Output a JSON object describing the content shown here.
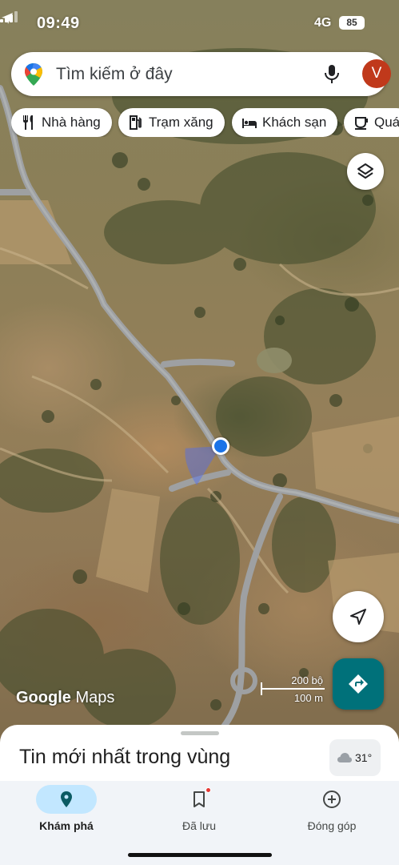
{
  "status_bar": {
    "time": "09:49",
    "network": "4G",
    "battery": "85"
  },
  "search": {
    "placeholder": "Tìm kiếm ở đây",
    "avatar_letter": "V"
  },
  "chips": [
    {
      "label": "Nhà hàng",
      "icon": "restaurant-icon"
    },
    {
      "label": "Trạm xăng",
      "icon": "gas-station-icon"
    },
    {
      "label": "Khách sạn",
      "icon": "hotel-icon"
    },
    {
      "label": "Quá",
      "icon": "coffee-icon"
    }
  ],
  "map": {
    "watermark_google": "Google",
    "watermark_maps": "Maps",
    "scale_top": "200 bộ",
    "scale_bottom": "100 m"
  },
  "sheet": {
    "title": "Tin mới nhất trong vùng",
    "weather_temp": "31°"
  },
  "bottom_nav": [
    {
      "label": "Khám phá",
      "icon": "explore-pin-icon",
      "active": true
    },
    {
      "label": "Đã lưu",
      "icon": "bookmark-icon",
      "active": false
    },
    {
      "label": "Đóng góp",
      "icon": "add-circle-icon",
      "active": false
    }
  ],
  "colors": {
    "accent_blue": "#1a73e8",
    "directions_teal": "#00717a",
    "avatar_red": "#c0391b",
    "active_pill": "#c2e7ff"
  }
}
